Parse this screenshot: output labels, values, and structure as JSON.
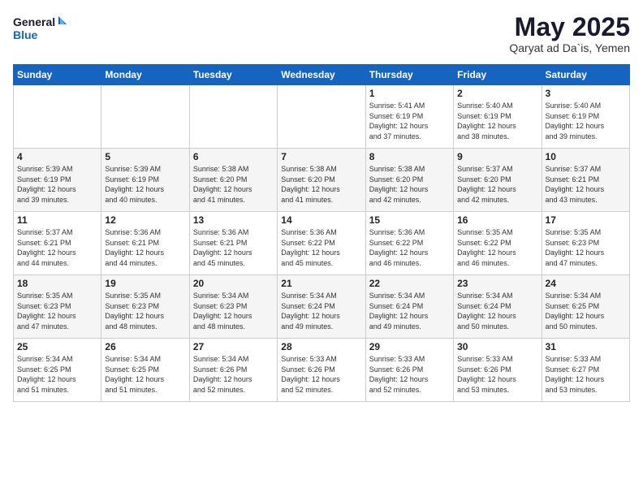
{
  "header": {
    "logo_line1": "General",
    "logo_line2": "Blue",
    "month": "May 2025",
    "location": "Qaryat ad Da`is, Yemen"
  },
  "weekdays": [
    "Sunday",
    "Monday",
    "Tuesday",
    "Wednesday",
    "Thursday",
    "Friday",
    "Saturday"
  ],
  "weeks": [
    [
      {
        "day": "",
        "info": ""
      },
      {
        "day": "",
        "info": ""
      },
      {
        "day": "",
        "info": ""
      },
      {
        "day": "",
        "info": ""
      },
      {
        "day": "1",
        "info": "Sunrise: 5:41 AM\nSunset: 6:19 PM\nDaylight: 12 hours\nand 37 minutes."
      },
      {
        "day": "2",
        "info": "Sunrise: 5:40 AM\nSunset: 6:19 PM\nDaylight: 12 hours\nand 38 minutes."
      },
      {
        "day": "3",
        "info": "Sunrise: 5:40 AM\nSunset: 6:19 PM\nDaylight: 12 hours\nand 39 minutes."
      }
    ],
    [
      {
        "day": "4",
        "info": "Sunrise: 5:39 AM\nSunset: 6:19 PM\nDaylight: 12 hours\nand 39 minutes."
      },
      {
        "day": "5",
        "info": "Sunrise: 5:39 AM\nSunset: 6:19 PM\nDaylight: 12 hours\nand 40 minutes."
      },
      {
        "day": "6",
        "info": "Sunrise: 5:38 AM\nSunset: 6:20 PM\nDaylight: 12 hours\nand 41 minutes."
      },
      {
        "day": "7",
        "info": "Sunrise: 5:38 AM\nSunset: 6:20 PM\nDaylight: 12 hours\nand 41 minutes."
      },
      {
        "day": "8",
        "info": "Sunrise: 5:38 AM\nSunset: 6:20 PM\nDaylight: 12 hours\nand 42 minutes."
      },
      {
        "day": "9",
        "info": "Sunrise: 5:37 AM\nSunset: 6:20 PM\nDaylight: 12 hours\nand 42 minutes."
      },
      {
        "day": "10",
        "info": "Sunrise: 5:37 AM\nSunset: 6:21 PM\nDaylight: 12 hours\nand 43 minutes."
      }
    ],
    [
      {
        "day": "11",
        "info": "Sunrise: 5:37 AM\nSunset: 6:21 PM\nDaylight: 12 hours\nand 44 minutes."
      },
      {
        "day": "12",
        "info": "Sunrise: 5:36 AM\nSunset: 6:21 PM\nDaylight: 12 hours\nand 44 minutes."
      },
      {
        "day": "13",
        "info": "Sunrise: 5:36 AM\nSunset: 6:21 PM\nDaylight: 12 hours\nand 45 minutes."
      },
      {
        "day": "14",
        "info": "Sunrise: 5:36 AM\nSunset: 6:22 PM\nDaylight: 12 hours\nand 45 minutes."
      },
      {
        "day": "15",
        "info": "Sunrise: 5:36 AM\nSunset: 6:22 PM\nDaylight: 12 hours\nand 46 minutes."
      },
      {
        "day": "16",
        "info": "Sunrise: 5:35 AM\nSunset: 6:22 PM\nDaylight: 12 hours\nand 46 minutes."
      },
      {
        "day": "17",
        "info": "Sunrise: 5:35 AM\nSunset: 6:23 PM\nDaylight: 12 hours\nand 47 minutes."
      }
    ],
    [
      {
        "day": "18",
        "info": "Sunrise: 5:35 AM\nSunset: 6:23 PM\nDaylight: 12 hours\nand 47 minutes."
      },
      {
        "day": "19",
        "info": "Sunrise: 5:35 AM\nSunset: 6:23 PM\nDaylight: 12 hours\nand 48 minutes."
      },
      {
        "day": "20",
        "info": "Sunrise: 5:34 AM\nSunset: 6:23 PM\nDaylight: 12 hours\nand 48 minutes."
      },
      {
        "day": "21",
        "info": "Sunrise: 5:34 AM\nSunset: 6:24 PM\nDaylight: 12 hours\nand 49 minutes."
      },
      {
        "day": "22",
        "info": "Sunrise: 5:34 AM\nSunset: 6:24 PM\nDaylight: 12 hours\nand 49 minutes."
      },
      {
        "day": "23",
        "info": "Sunrise: 5:34 AM\nSunset: 6:24 PM\nDaylight: 12 hours\nand 50 minutes."
      },
      {
        "day": "24",
        "info": "Sunrise: 5:34 AM\nSunset: 6:25 PM\nDaylight: 12 hours\nand 50 minutes."
      }
    ],
    [
      {
        "day": "25",
        "info": "Sunrise: 5:34 AM\nSunset: 6:25 PM\nDaylight: 12 hours\nand 51 minutes."
      },
      {
        "day": "26",
        "info": "Sunrise: 5:34 AM\nSunset: 6:25 PM\nDaylight: 12 hours\nand 51 minutes."
      },
      {
        "day": "27",
        "info": "Sunrise: 5:34 AM\nSunset: 6:26 PM\nDaylight: 12 hours\nand 52 minutes."
      },
      {
        "day": "28",
        "info": "Sunrise: 5:33 AM\nSunset: 6:26 PM\nDaylight: 12 hours\nand 52 minutes."
      },
      {
        "day": "29",
        "info": "Sunrise: 5:33 AM\nSunset: 6:26 PM\nDaylight: 12 hours\nand 52 minutes."
      },
      {
        "day": "30",
        "info": "Sunrise: 5:33 AM\nSunset: 6:26 PM\nDaylight: 12 hours\nand 53 minutes."
      },
      {
        "day": "31",
        "info": "Sunrise: 5:33 AM\nSunset: 6:27 PM\nDaylight: 12 hours\nand 53 minutes."
      }
    ]
  ]
}
